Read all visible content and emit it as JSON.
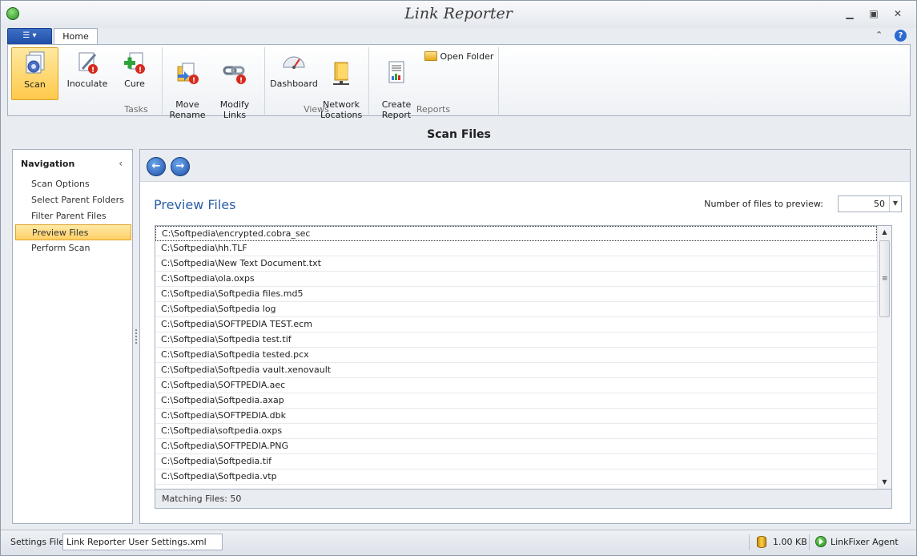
{
  "window": {
    "title": "Link Reporter",
    "min_icon": "minimize-icon",
    "restore_icon": "restore-icon",
    "close_icon": "close-icon"
  },
  "ribbon": {
    "tabs": [
      {
        "label": "Home",
        "active": true
      }
    ],
    "groups": {
      "tasks": {
        "label": "Tasks",
        "buttons": [
          {
            "label": "Scan",
            "icon": "scan-icon",
            "selected": true
          },
          {
            "label": "Inoculate",
            "icon": "inoculate-icon"
          },
          {
            "label": "Cure",
            "icon": "cure-icon"
          },
          {
            "label": "Move\nRename",
            "icon": "move-rename-icon"
          },
          {
            "label": "Modify\nLinks",
            "icon": "modify-links-icon"
          }
        ]
      },
      "views": {
        "label": "Views",
        "buttons": [
          {
            "label": "Dashboard",
            "icon": "dashboard-icon"
          },
          {
            "label": "Network\nLocations",
            "icon": "network-locations-icon"
          }
        ]
      },
      "reports": {
        "label": "Reports",
        "buttons": [
          {
            "label": "Create\nReport",
            "icon": "report-icon"
          },
          {
            "label": "Open Folder",
            "icon": "folder-icon"
          }
        ]
      }
    }
  },
  "page": {
    "heading": "Scan Files"
  },
  "navigation": {
    "title": "Navigation",
    "items": [
      {
        "label": "Scan Options"
      },
      {
        "label": "Select Parent Folders"
      },
      {
        "label": "Filter Parent Files"
      },
      {
        "label": "Preview Files",
        "selected": true
      },
      {
        "label": "Perform Scan"
      }
    ]
  },
  "preview": {
    "title": "Preview Files",
    "count_label": "Number of files to preview:",
    "count_value": "50",
    "files": [
      "C:\\Softpedia\\encrypted.cobra_sec",
      "C:\\Softpedia\\hh.TLF",
      "C:\\Softpedia\\New Text Document.txt",
      "C:\\Softpedia\\ola.oxps",
      "C:\\Softpedia\\Softpedia files.md5",
      "C:\\Softpedia\\Softpedia log",
      "C:\\Softpedia\\SOFTPEDIA TEST.ecm",
      "C:\\Softpedia\\Softpedia test.tif",
      "C:\\Softpedia\\Softpedia tested.pcx",
      "C:\\Softpedia\\Softpedia vault.xenovault",
      "C:\\Softpedia\\SOFTPEDIA.aec",
      "C:\\Softpedia\\Softpedia.axap",
      "C:\\Softpedia\\SOFTPEDIA.dbk",
      "C:\\Softpedia\\softpedia.oxps",
      "C:\\Softpedia\\SOFTPEDIA.PNG",
      "C:\\Softpedia\\Softpedia.tif",
      "C:\\Softpedia\\Softpedia.vtp"
    ],
    "matching": "Matching Files: 50"
  },
  "statusbar": {
    "settings_label": "Settings File:",
    "settings_value": "Link Reporter User Settings.xml",
    "size": "1.00 KB",
    "agent": "LinkFixer Agent"
  },
  "colors": {
    "accent": "#2a5fa4",
    "selection": "#ffd065",
    "app_menu": "#1f4ea5"
  }
}
